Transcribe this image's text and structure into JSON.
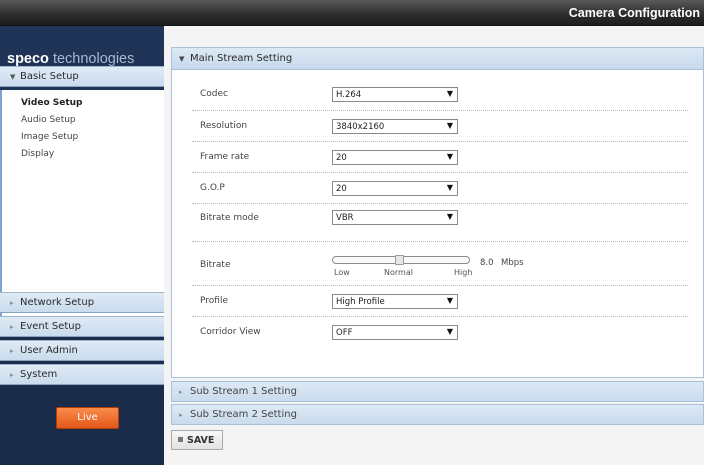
{
  "header": {
    "title": "Camera Configuration"
  },
  "logo": {
    "part1": "speco",
    "part2": " technologies"
  },
  "sidebar": {
    "basic_setup": "Basic Setup",
    "submenu": [
      "Video Setup",
      "Audio Setup",
      "Image Setup",
      "Display"
    ],
    "network_setup": "Network Setup",
    "event_setup": "Event Setup",
    "user_admin": "User Admin",
    "system": "System",
    "live_label": "Live"
  },
  "main_stream": {
    "title": "Main Stream Setting",
    "codec": {
      "label": "Codec",
      "value": "H.264"
    },
    "resolution": {
      "label": "Resolution",
      "value": "3840x2160"
    },
    "frame_rate": {
      "label": "Frame rate",
      "value": "20"
    },
    "gop": {
      "label": "G.O.P",
      "value": "20"
    },
    "bitrate_mode": {
      "label": "Bitrate mode",
      "value": "VBR"
    },
    "bitrate": {
      "label": "Bitrate",
      "low": "Low",
      "normal": "Normal",
      "high": "High",
      "value": "8.0",
      "unit": "Mbps"
    },
    "profile": {
      "label": "Profile",
      "value": "High Profile"
    },
    "corridor_view": {
      "label": "Corridor View",
      "value": "OFF"
    }
  },
  "sub_stream_1": {
    "title": "Sub Stream 1 Setting"
  },
  "sub_stream_2": {
    "title": "Sub Stream 2 Setting"
  },
  "save_label": "SAVE",
  "icons": {
    "expanded": "triangle-down-icon",
    "collapsed": "triangle-right-icon",
    "dropdown": "dropdown-caret-icon",
    "save": "save-square-icon"
  }
}
